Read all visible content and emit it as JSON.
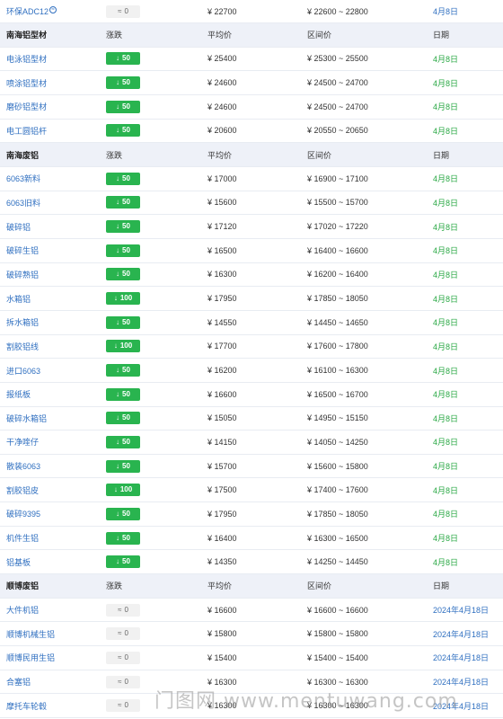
{
  "headers": {
    "change": "涨跌",
    "avg": "平均价",
    "range": "区间价",
    "date": "日期"
  },
  "top_row": {
    "name": "环保ADC12",
    "change": "0",
    "avg": "¥ 22700",
    "range": "¥ 22600 ~ 22800",
    "date": "4月8日"
  },
  "sections": [
    {
      "title": "南海铝型材",
      "rows": [
        {
          "name": "电泳铝型材",
          "change": "50",
          "dir": "down",
          "avg": "¥ 25400",
          "range": "¥ 25300 ~ 25500",
          "date": "4月8日"
        },
        {
          "name": "喷涂铝型材",
          "change": "50",
          "dir": "down",
          "avg": "¥ 24600",
          "range": "¥ 24500 ~ 24700",
          "date": "4月8日"
        },
        {
          "name": "磨砂铝型材",
          "change": "50",
          "dir": "down",
          "avg": "¥ 24600",
          "range": "¥ 24500 ~ 24700",
          "date": "4月8日"
        },
        {
          "name": "电工圆铝杆",
          "change": "50",
          "dir": "down",
          "avg": "¥ 20600",
          "range": "¥ 20550 ~ 20650",
          "date": "4月8日"
        }
      ]
    },
    {
      "title": "南海废铝",
      "rows": [
        {
          "name": "6063新料",
          "change": "50",
          "dir": "down",
          "avg": "¥ 17000",
          "range": "¥ 16900 ~ 17100",
          "date": "4月8日"
        },
        {
          "name": "6063旧料",
          "change": "50",
          "dir": "down",
          "avg": "¥ 15600",
          "range": "¥ 15500 ~ 15700",
          "date": "4月8日"
        },
        {
          "name": "破碎铝",
          "change": "50",
          "dir": "down",
          "avg": "¥ 17120",
          "range": "¥ 17020 ~ 17220",
          "date": "4月8日"
        },
        {
          "name": "破碎生铝",
          "change": "50",
          "dir": "down",
          "avg": "¥ 16500",
          "range": "¥ 16400 ~ 16600",
          "date": "4月8日"
        },
        {
          "name": "破碎熟铝",
          "change": "50",
          "dir": "down",
          "avg": "¥ 16300",
          "range": "¥ 16200 ~ 16400",
          "date": "4月8日"
        },
        {
          "name": "水箱铝",
          "change": "100",
          "dir": "down",
          "avg": "¥ 17950",
          "range": "¥ 17850 ~ 18050",
          "date": "4月8日"
        },
        {
          "name": "拆水箱铝",
          "change": "50",
          "dir": "down",
          "avg": "¥ 14550",
          "range": "¥ 14450 ~ 14650",
          "date": "4月8日"
        },
        {
          "name": "割胶铝线",
          "change": "100",
          "dir": "down",
          "avg": "¥ 17700",
          "range": "¥ 17600 ~ 17800",
          "date": "4月8日"
        },
        {
          "name": "进口6063",
          "change": "50",
          "dir": "down",
          "avg": "¥ 16200",
          "range": "¥ 16100 ~ 16300",
          "date": "4月8日"
        },
        {
          "name": "报纸板",
          "change": "50",
          "dir": "down",
          "avg": "¥ 16600",
          "range": "¥ 16500 ~ 16700",
          "date": "4月8日"
        },
        {
          "name": "破碎水箱铝",
          "change": "50",
          "dir": "down",
          "avg": "¥ 15050",
          "range": "¥ 14950 ~ 15150",
          "date": "4月8日"
        },
        {
          "name": "干净喹仔",
          "change": "50",
          "dir": "down",
          "avg": "¥ 14150",
          "range": "¥ 14050 ~ 14250",
          "date": "4月8日"
        },
        {
          "name": "散装6063",
          "change": "50",
          "dir": "down",
          "avg": "¥ 15700",
          "range": "¥ 15600 ~ 15800",
          "date": "4月8日"
        },
        {
          "name": "割胶铝皮",
          "change": "100",
          "dir": "down",
          "avg": "¥ 17500",
          "range": "¥ 17400 ~ 17600",
          "date": "4月8日"
        },
        {
          "name": "破碎9395",
          "change": "50",
          "dir": "down",
          "avg": "¥ 17950",
          "range": "¥ 17850 ~ 18050",
          "date": "4月8日"
        },
        {
          "name": "机件生铝",
          "change": "50",
          "dir": "down",
          "avg": "¥ 16400",
          "range": "¥ 16300 ~ 16500",
          "date": "4月8日"
        },
        {
          "name": "铝基板",
          "change": "50",
          "dir": "down",
          "avg": "¥ 14350",
          "range": "¥ 14250 ~ 14450",
          "date": "4月8日"
        }
      ]
    },
    {
      "title": "顺博废铝",
      "rows": [
        {
          "name": "大件机铝",
          "change": "0",
          "dir": "flat",
          "avg": "¥ 16600",
          "range": "¥ 16600 ~ 16600",
          "date": "2024年4月18日"
        },
        {
          "name": "顺博机械生铝",
          "change": "0",
          "dir": "flat",
          "avg": "¥ 15800",
          "range": "¥ 15800 ~ 15800",
          "date": "2024年4月18日"
        },
        {
          "name": "顺博民用生铝",
          "change": "0",
          "dir": "flat",
          "avg": "¥ 15400",
          "range": "¥ 15400 ~ 15400",
          "date": "2024年4月18日"
        },
        {
          "name": "合塞铝",
          "change": "0",
          "dir": "flat",
          "avg": "¥ 16300",
          "range": "¥ 16300 ~ 16300",
          "date": "2024年4月18日"
        },
        {
          "name": "摩托车轮毂",
          "change": "0",
          "dir": "flat",
          "avg": "¥ 16300",
          "range": "¥ 16300 ~ 16300",
          "date": "2024年4月18日"
        }
      ]
    }
  ],
  "watermark": "门图网 www.mentuwang.com",
  "colors": {
    "down": "#29b44f",
    "flat": "#f1f1f1",
    "link": "#2f6fc0",
    "date_green": "#29a844",
    "header_bg": "#eef1f8"
  },
  "icons": {
    "down": "arrow-down-icon",
    "flat": "approx-icon"
  }
}
